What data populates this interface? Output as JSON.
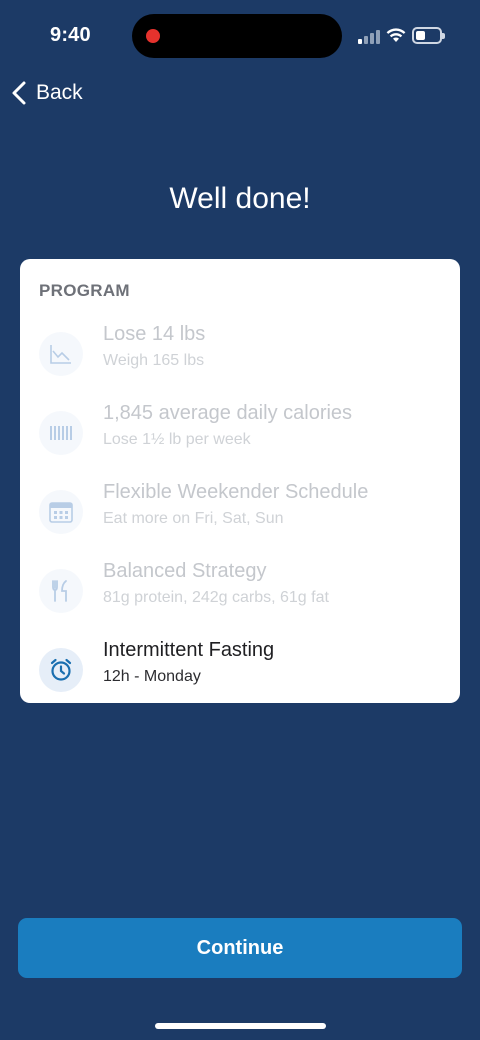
{
  "status_bar": {
    "time": "9:40"
  },
  "nav": {
    "back_label": "Back"
  },
  "title": "Well done!",
  "card": {
    "header": "PROGRAM",
    "items": [
      {
        "icon": "chart-trend-icon",
        "label": "Lose 14 lbs",
        "sub": "Weigh 165 lbs",
        "state": "faded"
      },
      {
        "icon": "barcode-icon",
        "label": "1,845 average daily calories",
        "sub": "Lose 1½ lb per week",
        "state": "faded"
      },
      {
        "icon": "calendar-icon",
        "label": "Flexible Weekender Schedule",
        "sub": "Eat more on Fri, Sat, Sun",
        "state": "faded"
      },
      {
        "icon": "fork-knife-icon",
        "label": "Balanced Strategy",
        "sub": "81g protein, 242g carbs, 61g fat",
        "state": "faded"
      },
      {
        "icon": "alarm-clock-icon",
        "label": "Intermittent Fasting",
        "sub": "12h - Monday",
        "state": "active"
      }
    ]
  },
  "continue_label": "Continue",
  "colors": {
    "background": "#1c3a66",
    "accent": "#1a7dbf",
    "card": "#ffffff",
    "icon": "#1a6fb0"
  }
}
